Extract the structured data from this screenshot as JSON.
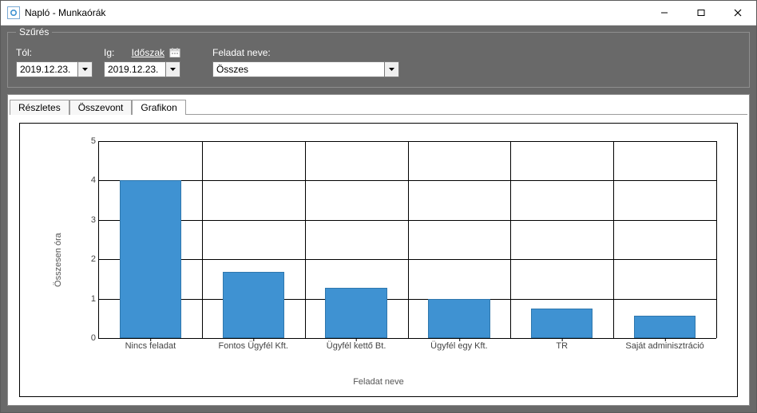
{
  "window": {
    "title": "Napló - Munkaórák"
  },
  "filters": {
    "group_title": "Szűrés",
    "from_label": "Tól:",
    "to_label": "Ig:",
    "period_link": "Időszak",
    "task_label": "Feladat neve:",
    "from_value": "2019.12.23.",
    "to_value": "2019.12.23.",
    "task_value": "Összes"
  },
  "tabs": {
    "detailed": "Részletes",
    "summary": "Összevont",
    "chart": "Grafikon",
    "active": "chart"
  },
  "chart_data": {
    "type": "bar",
    "categories": [
      "Nincs feladat",
      "Fontos Ügyfél Kft.",
      "Ügyfél kettő Bt.",
      "Ügyfél egy Kft.",
      "TR",
      "Saját adminisztráció"
    ],
    "values": [
      4.0,
      1.68,
      1.28,
      1.0,
      0.75,
      0.56
    ],
    "title": "",
    "xlabel": "Feladat neve",
    "ylabel": "Összesen óra",
    "ylim": [
      0,
      5
    ],
    "yticks": [
      0,
      1,
      2,
      3,
      4,
      5
    ]
  }
}
